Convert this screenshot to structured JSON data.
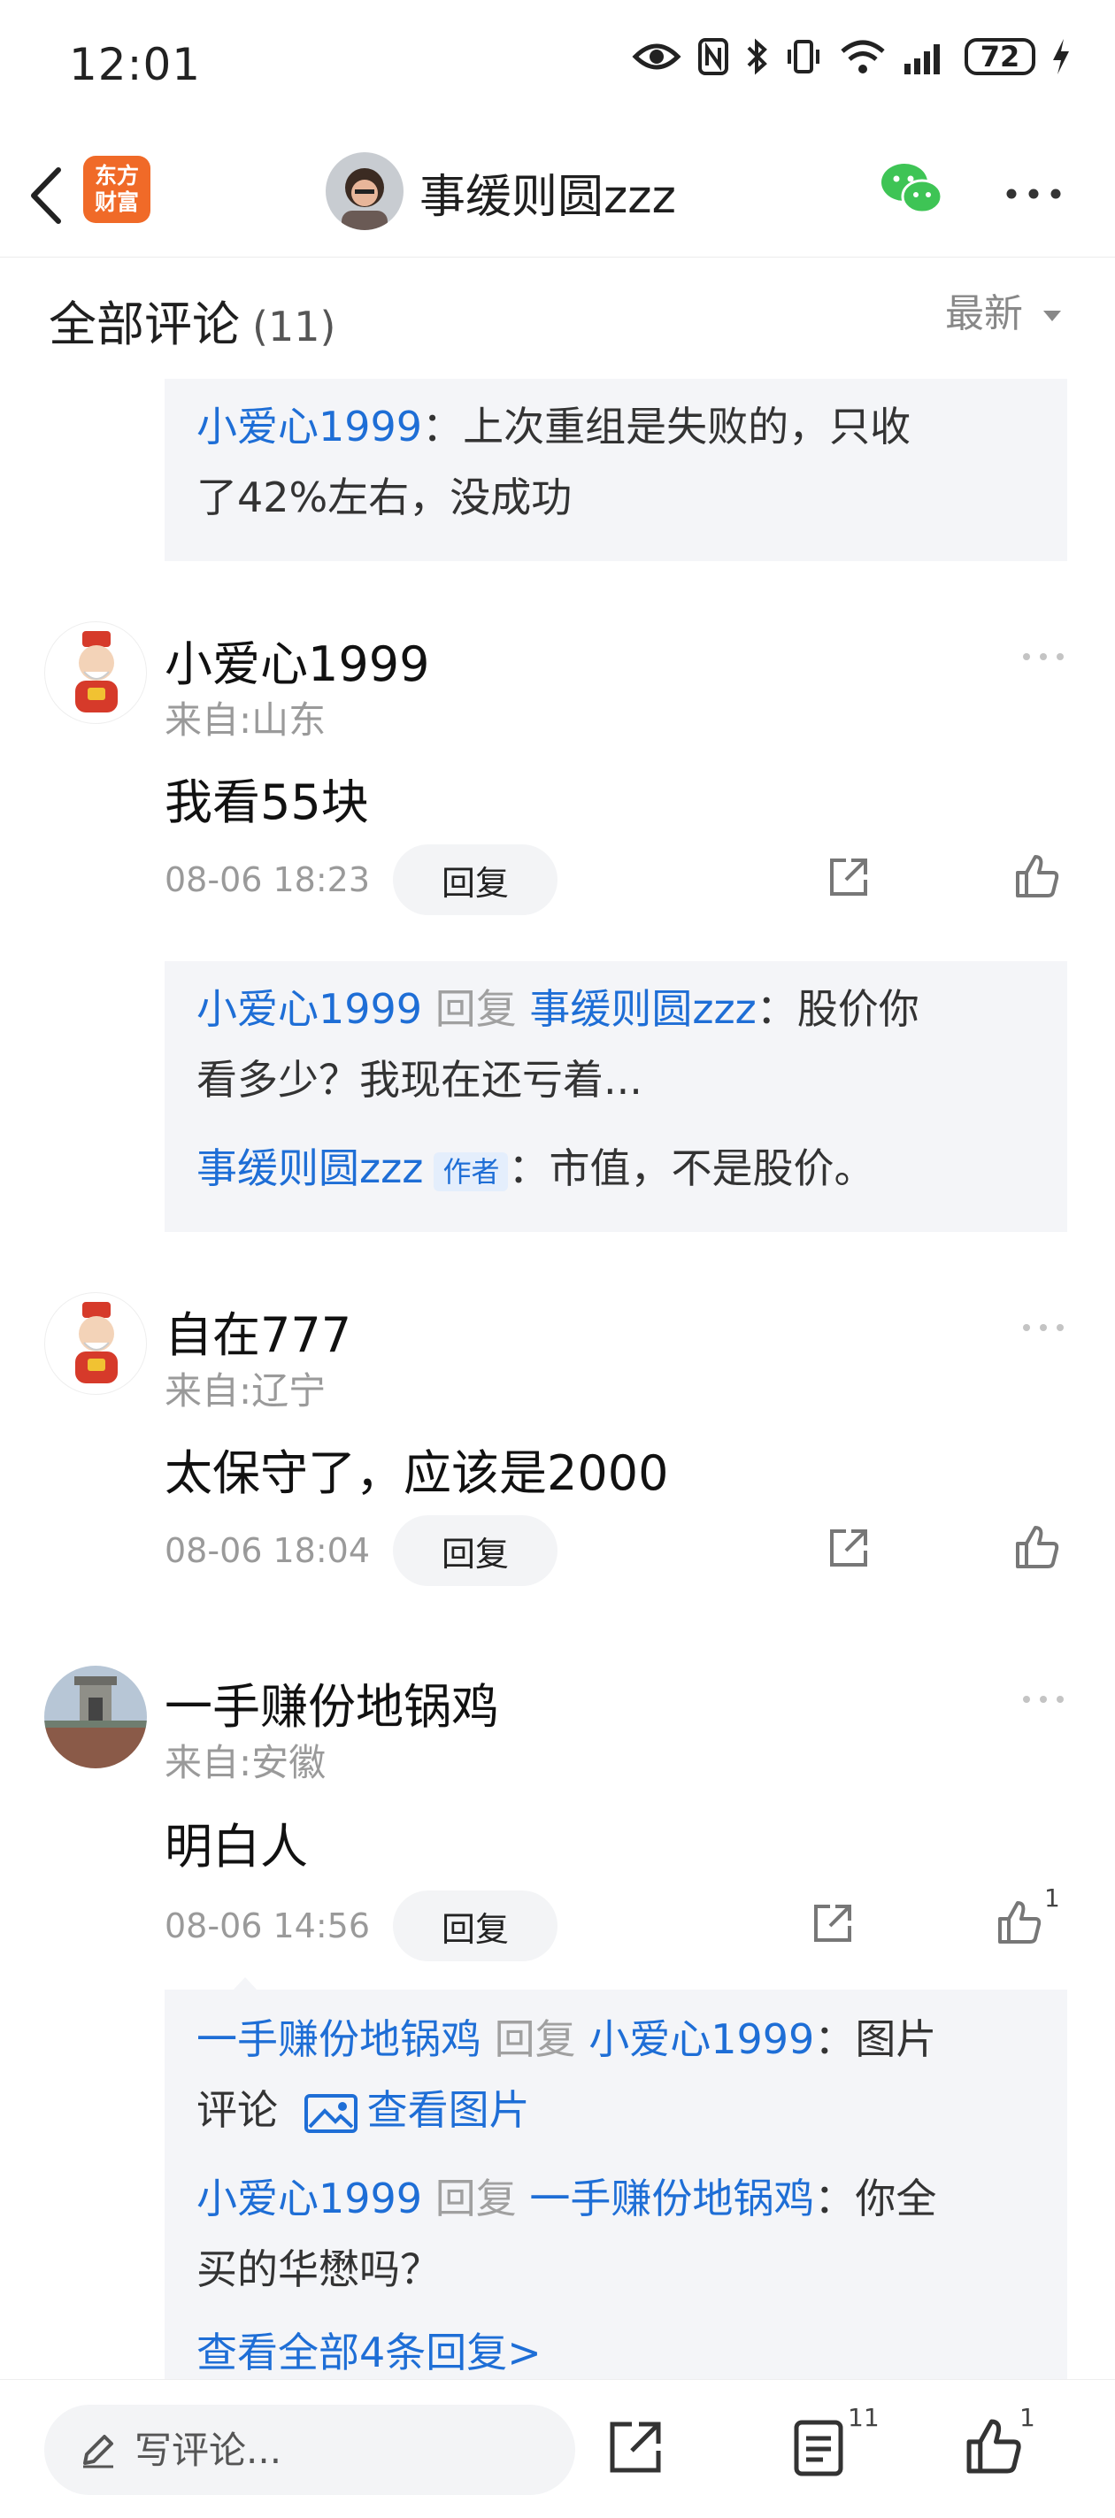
{
  "status_bar": {
    "time": "12:01",
    "battery": "72"
  },
  "header": {
    "brand_logo_top": "东方",
    "brand_logo_bottom": "财富",
    "title": "事缓则圆zzz"
  },
  "comments_header": {
    "title": "全部评论",
    "count": "(11)",
    "sort": "最新"
  },
  "top_reply": {
    "user": "小爱心1999",
    "text": "：上次重组是失败的，只收",
    "text_cont": "了42%左右，没成功"
  },
  "comments": [
    {
      "user": "小爱心1999",
      "location": "来自:山东",
      "text": "我看55块",
      "time": "08-06 18:23",
      "reply_label": "回复",
      "replies": [
        {
          "user": "小爱心1999",
          "verb": "回复",
          "target": "事缓则圆zzz",
          "text": "：股价你",
          "text_cont": "看多少？我现在还亏着..."
        },
        {
          "user": "事缓则圆zzz",
          "tag": "作者",
          "text": "：市值，不是股价。"
        }
      ]
    },
    {
      "user": "自在777",
      "location": "来自:辽宁",
      "text": "太保守了，应该是2000",
      "time": "08-06 18:04",
      "reply_label": "回复"
    },
    {
      "user": "一手赚份地锅鸡",
      "location": "来自:安徽",
      "text": "明白人",
      "time": "08-06 14:56",
      "reply_label": "回复",
      "like_count": "1",
      "replies": [
        {
          "user": "一手赚份地锅鸡",
          "verb": "回复",
          "target": "小爱心1999",
          "text": "：图片",
          "text_cont_prefix": "评论",
          "link": "查看图片"
        },
        {
          "user": "小爱心1999",
          "verb": "回复",
          "target": "一手赚份地锅鸡",
          "text": "：你全",
          "text_cont": "买的华懋吗？"
        }
      ],
      "view_all": "查看全部4条回复>"
    }
  ],
  "bottom_bar": {
    "placeholder": "写评论...",
    "comment_count": "11",
    "like_count": "1"
  },
  "colors": {
    "accent_blue": "#1e6ed6",
    "brand_orange": "#f06a28",
    "wechat_green": "#3ec455"
  }
}
